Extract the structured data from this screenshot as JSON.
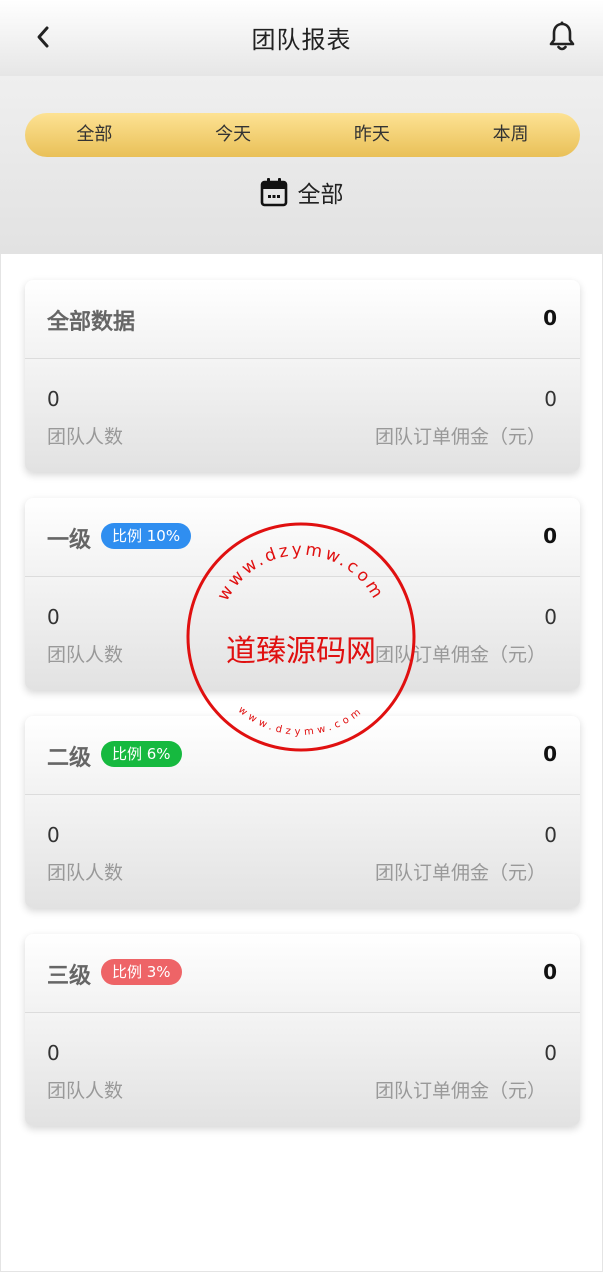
{
  "header": {
    "title": "团队报表",
    "back_icon": "chevron-left-icon",
    "bell_icon": "bell-icon"
  },
  "filters": {
    "tabs": [
      "全部",
      "今天",
      "昨天",
      "本周"
    ],
    "selected_date_label": "全部",
    "tab_bar_color": "#f5d273"
  },
  "cards": [
    {
      "title": "全部数据",
      "badge": null,
      "total": "0",
      "members": "0",
      "members_label": "团队人数",
      "commission": "0",
      "commission_label": "团队订单佣金（元）"
    },
    {
      "title": "一级",
      "badge": "比例 10%",
      "badge_color": "#2f8ef0",
      "total": "0",
      "members": "0",
      "members_label": "团队人数",
      "commission": "0",
      "commission_label": "团队订单佣金（元）"
    },
    {
      "title": "二级",
      "badge": "比例 6%",
      "badge_color": "#16b93f",
      "total": "0",
      "members": "0",
      "members_label": "团队人数",
      "commission": "0",
      "commission_label": "团队订单佣金（元）"
    },
    {
      "title": "三级",
      "badge": "比例 3%",
      "badge_color": "#ee6467",
      "total": "0",
      "members": "0",
      "members_label": "团队人数",
      "commission": "0",
      "commission_label": "团队订单佣金（元）"
    }
  ],
  "watermark": {
    "text": "道臻源码网",
    "ring_top": "www.dzymw.com",
    "ring_bottom": "www.dzymw.com",
    "color": "#e01010"
  }
}
